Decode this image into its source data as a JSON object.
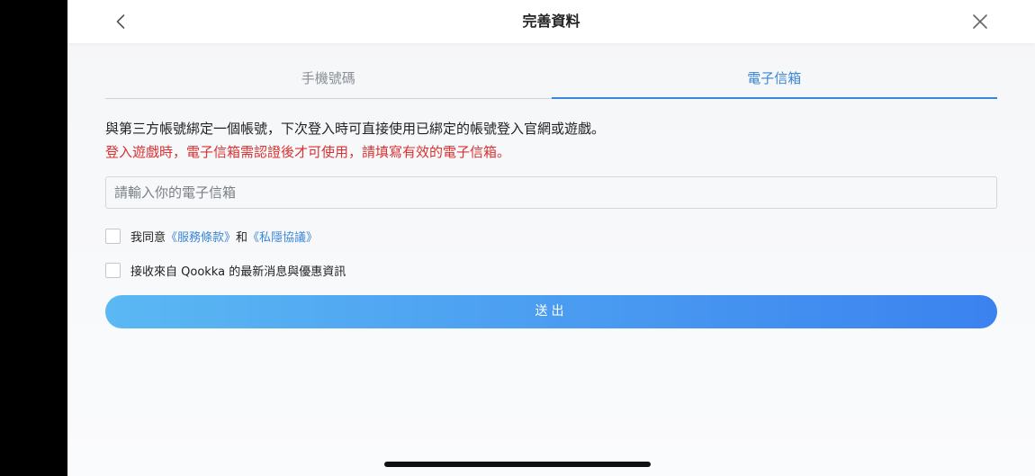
{
  "header": {
    "title": "完善資料",
    "back_icon": "chevron-left-icon",
    "close_icon": "close-icon"
  },
  "tabs": [
    {
      "label": "手機號碼",
      "active": false
    },
    {
      "label": "電子信箱",
      "active": true
    }
  ],
  "notice": {
    "main": "與第三方帳號綁定一個帳號，下次登入時可直接使用已綁定的帳號登入官網或遊戲。",
    "warning": "登入遊戲時，電子信箱需認證後才可使用，請填寫有效的電子信箱。"
  },
  "email": {
    "value": "",
    "placeholder": "請輸入你的電子信箱"
  },
  "agreement": {
    "prefix": "我同意",
    "terms_link": "《服務條款》",
    "joiner": "和",
    "privacy_link": "《私隱協議》",
    "checked": false
  },
  "newsletter": {
    "label": "接收來自 Qookka 的最新消息與優惠資訊",
    "checked": false
  },
  "submit": {
    "label": "送出"
  },
  "colors": {
    "accent": "#3a86d8",
    "warning": "#d83232",
    "button_gradient_start": "#5bb8f3",
    "button_gradient_end": "#3b82ef"
  }
}
